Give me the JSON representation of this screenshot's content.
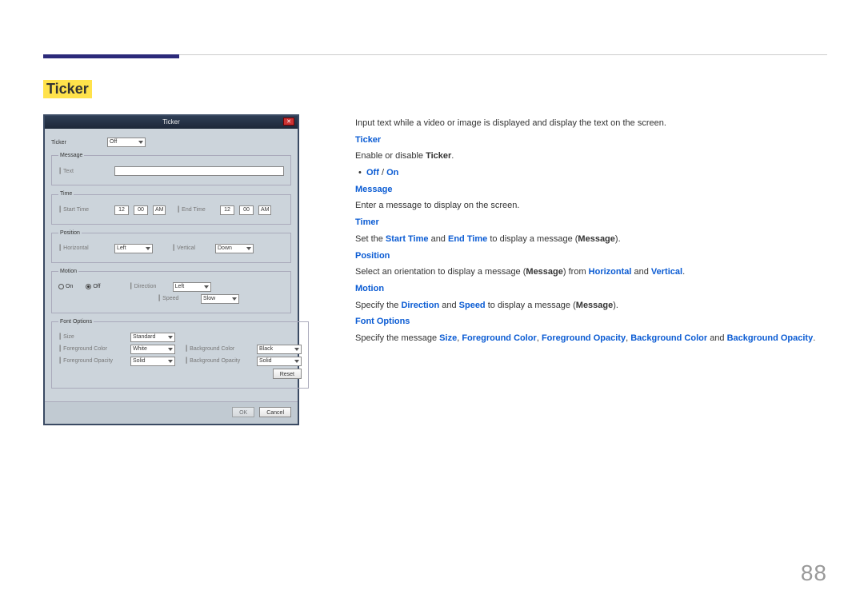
{
  "page_number": "88",
  "section_title": "Ticker",
  "dialog": {
    "title": "Ticker",
    "close_glyph": "✕",
    "ticker_label": "Ticker",
    "ticker_value": "Off",
    "message_group": "Message",
    "message_label": "Text",
    "time_group": "Time",
    "start_time_label": "Start Time",
    "end_time_label": "End Time",
    "start_hh": "12",
    "start_mm": "00",
    "start_ampm": "AM",
    "end_hh": "12",
    "end_mm": "00",
    "end_ampm": "AM",
    "position_group": "Position",
    "horizontal_label": "Horizontal",
    "horizontal_value": "Left",
    "vertical_label": "Vertical",
    "vertical_value": "Down",
    "motion_group": "Motion",
    "on_label": "On",
    "off_label": "Off",
    "direction_label": "Direction",
    "direction_value": "Left",
    "speed_label": "Speed",
    "speed_value": "Slow",
    "fontopts_group": "Font Options",
    "size_label": "Size",
    "size_value": "Standard",
    "fg_color_label": "Foreground Color",
    "fg_color_value": "White",
    "bg_color_label": "Background Color",
    "bg_color_value": "Black",
    "fg_opacity_label": "Foreground Opacity",
    "fg_opacity_value": "Solid",
    "bg_opacity_label": "Background Opacity",
    "bg_opacity_value": "Solid",
    "reset_btn": "Reset",
    "ok_btn": "OK",
    "cancel_btn": "Cancel"
  },
  "doc": {
    "intro": "Input text while a video or image is displayed and display the text on the screen.",
    "ticker_h": "Ticker",
    "ticker_p1a": "Enable or disable ",
    "ticker_p1b": "Ticker",
    "ticker_p1c": ".",
    "off": "Off",
    "slash": " / ",
    "on": "On",
    "message_h": "Message",
    "message_p": "Enter a message to display on the screen.",
    "timer_h": "Timer",
    "timer_p1": "Set the ",
    "start_time": "Start Time",
    "and": " and ",
    "end_time": "End Time",
    "timer_p2": " to display a message (",
    "msg_word": "Message",
    "paren_close": ").",
    "position_h": "Position",
    "position_p1": "Select an orientation to display a message (",
    "position_p2": ") from ",
    "horizontal": "Horizontal",
    "vertical": "Vertical",
    "period": ".",
    "motion_h": "Motion",
    "motion_p1": "Specify the ",
    "direction": "Direction",
    "speed": "Speed",
    "motion_p2": " to display a message (",
    "fontopts_h": "Font Options",
    "fontopts_p1": "Specify the message ",
    "size": "Size",
    "comma": ", ",
    "fg_color": "Foreground Color",
    "fg_opacity": "Foreground Opacity",
    "bg_color": "Background Color",
    "bg_opacity": "Background Opacity"
  }
}
